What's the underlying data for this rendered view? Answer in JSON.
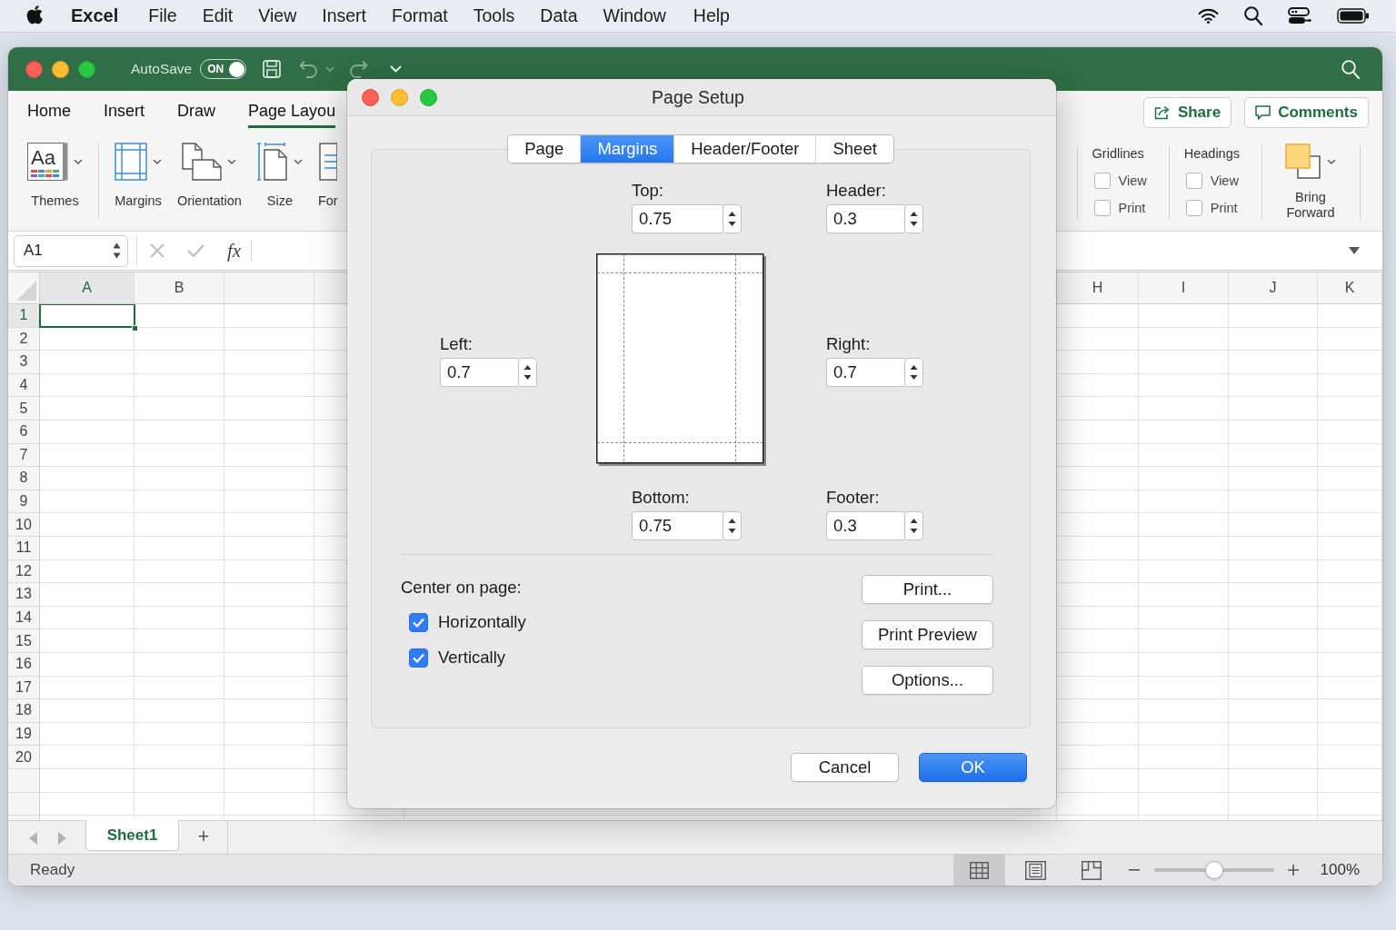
{
  "menu_bar": {
    "app_name": "Excel",
    "items": [
      "File",
      "Edit",
      "View",
      "Insert",
      "Format",
      "Tools",
      "Data",
      "Window",
      "Help"
    ]
  },
  "title_bar": {
    "autosave": {
      "label": "AutoSave",
      "state_text": "ON",
      "on": true
    },
    "quick_access": [
      {
        "kind": "save",
        "disabled": false
      },
      {
        "kind": "undo",
        "disabled": true
      },
      {
        "kind": "redo",
        "disabled": true
      }
    ]
  },
  "ribbon_tabs": [
    {
      "label": "Home",
      "selected": false
    },
    {
      "label": "Insert",
      "selected": false
    },
    {
      "label": "Draw",
      "selected": false
    },
    {
      "label": "Page Layou",
      "selected": true
    }
  ],
  "ribbon_actions": [
    {
      "kind": "share",
      "label": "Share"
    },
    {
      "kind": "comments",
      "label": "Comments"
    }
  ],
  "ribbon_commands": [
    {
      "kind": "themes",
      "label": "Themes",
      "icon_text": "Aa"
    },
    {
      "kind": "margins",
      "label": "Margins"
    },
    {
      "kind": "orientation",
      "label": "Orientation"
    },
    {
      "kind": "size",
      "label": "Size"
    },
    {
      "kind": "document",
      "label": "For"
    }
  ],
  "sheet_options": [
    {
      "title": "Gridlines",
      "options": [
        {
          "label": "View",
          "checked": false
        },
        {
          "label": "Print",
          "checked": false
        }
      ]
    },
    {
      "title": "Headings",
      "options": [
        {
          "label": "View",
          "checked": false
        },
        {
          "label": "Print",
          "checked": false
        }
      ]
    }
  ],
  "arrange": {
    "label": "Bring Forward"
  },
  "formula_bar": {
    "name_box": "A1",
    "function_label": "fx"
  },
  "sheet": {
    "columns_left": [
      {
        "label": "A",
        "selected": true
      },
      {
        "label": "B",
        "selected": false
      }
    ],
    "columns_right": [
      {
        "label": "H",
        "selected": false
      },
      {
        "label": "I",
        "selected": false
      },
      {
        "label": "J",
        "selected": false
      },
      {
        "label": "K",
        "selected": false
      }
    ],
    "rows": [
      {
        "label": "1",
        "selected": true
      },
      {
        "label": "2",
        "selected": false
      },
      {
        "label": "3",
        "selected": false
      },
      {
        "label": "4",
        "selected": false
      },
      {
        "label": "5",
        "selected": false
      },
      {
        "label": "6",
        "selected": false
      },
      {
        "label": "7",
        "selected": false
      },
      {
        "label": "8",
        "selected": false
      },
      {
        "label": "9",
        "selected": false
      },
      {
        "label": "10",
        "selected": false
      },
      {
        "label": "11",
        "selected": false
      },
      {
        "label": "12",
        "selected": false
      },
      {
        "label": "13",
        "selected": false
      },
      {
        "label": "14",
        "selected": false
      },
      {
        "label": "15",
        "selected": false
      },
      {
        "label": "16",
        "selected": false
      },
      {
        "label": "17",
        "selected": false
      },
      {
        "label": "18",
        "selected": false
      },
      {
        "label": "19",
        "selected": false
      },
      {
        "label": "20",
        "selected": false
      }
    ]
  },
  "sheet_tabs": {
    "tabs": [
      {
        "label": "Sheet1",
        "selected": true
      }
    ],
    "add_label": "+"
  },
  "status_bar": {
    "status": "Ready",
    "views": [
      {
        "kind": "normal",
        "selected": true
      },
      {
        "kind": "page_layout",
        "selected": false
      },
      {
        "kind": "page_break",
        "selected": false
      }
    ],
    "zoom": {
      "level": 0.5,
      "reading": "100%"
    }
  },
  "dialog": {
    "title": "Page Setup",
    "tabs": [
      {
        "label": "Page",
        "selected": false
      },
      {
        "label": "Margins",
        "selected": true
      },
      {
        "label": "Header/Footer",
        "selected": false
      },
      {
        "label": "Sheet",
        "selected": false
      }
    ],
    "margins": {
      "top": {
        "label": "Top:",
        "value": "0.75"
      },
      "header": {
        "label": "Header:",
        "value": "0.3"
      },
      "left": {
        "label": "Left:",
        "value": "0.7"
      },
      "right": {
        "label": "Right:",
        "value": "0.7"
      },
      "bottom": {
        "label": "Bottom:",
        "value": "0.75"
      },
      "footer": {
        "label": "Footer:",
        "value": "0.3"
      }
    },
    "center_on_page": {
      "label": "Center on page:",
      "options": [
        {
          "label": "Horizontally",
          "checked": true
        },
        {
          "label": "Vertically",
          "checked": true
        }
      ]
    },
    "side_buttons": [
      "Print...",
      "Print Preview",
      "Options..."
    ],
    "buttons": [
      {
        "label": "Cancel",
        "default": false
      },
      {
        "label": "OK",
        "default": true
      }
    ]
  }
}
